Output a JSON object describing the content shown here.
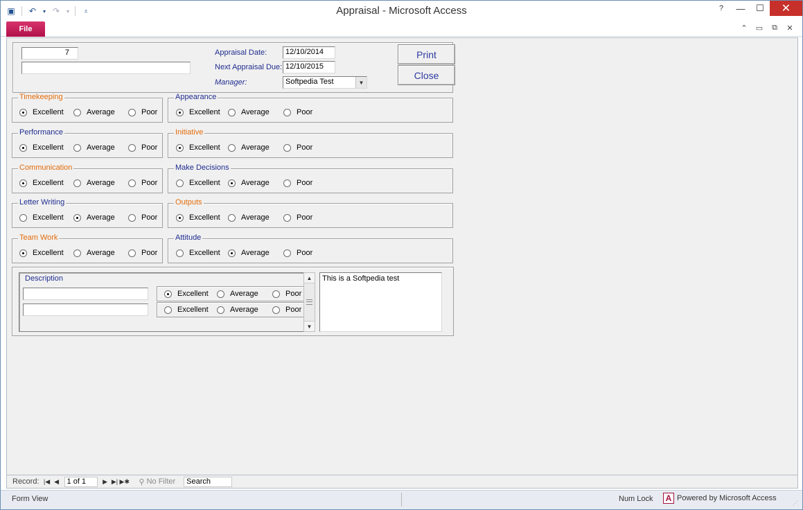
{
  "window": {
    "title": "Appraisal  -  Microsoft Access"
  },
  "ribbon": {
    "file_tab": "File"
  },
  "header": {
    "id_value": "7",
    "name_value": "",
    "appraisal_date_label": "Appraisal Date:",
    "appraisal_date_value": "12/10/2014",
    "next_due_label": "Next Appraisal Due:",
    "next_due_value": "12/10/2015",
    "manager_label": "Manager:",
    "manager_value": "Softpedia Test",
    "print_button": "Print",
    "close_button": "Close"
  },
  "options": {
    "excellent": "Excellent",
    "average": "Average",
    "poor": "Poor"
  },
  "groups": [
    {
      "title": "Timekeeping",
      "color": "#e36c0a",
      "selected": "excellent"
    },
    {
      "title": "Appearance",
      "color": "#1f2d8f",
      "selected": "excellent"
    },
    {
      "title": "Performance",
      "color": "#1f2d8f",
      "selected": "excellent"
    },
    {
      "title": "Initiative",
      "color": "#e36c0a",
      "selected": "excellent"
    },
    {
      "title": "Communication",
      "color": "#e36c0a",
      "selected": "excellent"
    },
    {
      "title": "Make Decisions",
      "color": "#1f2d8f",
      "selected": "average"
    },
    {
      "title": "Letter Writing",
      "color": "#1f2d8f",
      "selected": "average"
    },
    {
      "title": "Outputs",
      "color": "#e36c0a",
      "selected": "excellent"
    },
    {
      "title": "Team Work",
      "color": "#e36c0a",
      "selected": "excellent"
    },
    {
      "title": "Attitude",
      "color": "#1f2d8f",
      "selected": "average"
    }
  ],
  "subform": {
    "description_label": "Description",
    "rows": [
      {
        "value": "",
        "selected": "excellent"
      },
      {
        "value": "",
        "selected": "none"
      }
    ],
    "memo_text": "This is a Softpedia test"
  },
  "navigator": {
    "record_label": "Record:",
    "position": "1 of 1",
    "no_filter": "No Filter",
    "search_placeholder": "Search"
  },
  "status": {
    "view": "Form View",
    "num_lock": "Num Lock",
    "powered_by": "Powered by Microsoft Access"
  }
}
